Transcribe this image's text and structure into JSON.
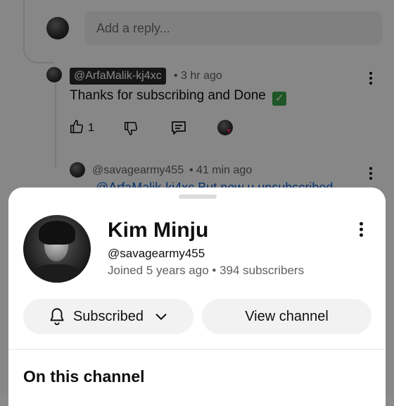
{
  "background": {
    "reply_placeholder": "Add a reply...",
    "reply": {
      "author": "@ArfaMalik-kj4xc",
      "time": "• 3 hr ago",
      "text": "Thanks for subscribing and Done",
      "like_count": "1"
    },
    "next_comment": {
      "author": "@savagearmy455",
      "time": "• 41 min ago",
      "text_fragment": "@ArfaMalik-kj4xc But now u unsubscribed"
    }
  },
  "channel_sheet": {
    "name": "Kim Minju",
    "handle": "@savagearmy455",
    "joined": "Joined 5 years ago",
    "subscribers": "• 394 subscribers",
    "subscribed_label": "Subscribed",
    "view_channel_label": "View channel",
    "section_title": "On this channel"
  },
  "colors": {
    "accent_link": "#065fd4",
    "button_bg": "#f2f2f2",
    "heart": "#e0245e",
    "check": "#3ca24a"
  },
  "icons": [
    "bell-icon",
    "chevron-down-icon",
    "thumbs-up-icon",
    "thumbs-down-icon",
    "reply-icon",
    "more-vert-icon",
    "heart-icon",
    "check-mark-icon"
  ]
}
